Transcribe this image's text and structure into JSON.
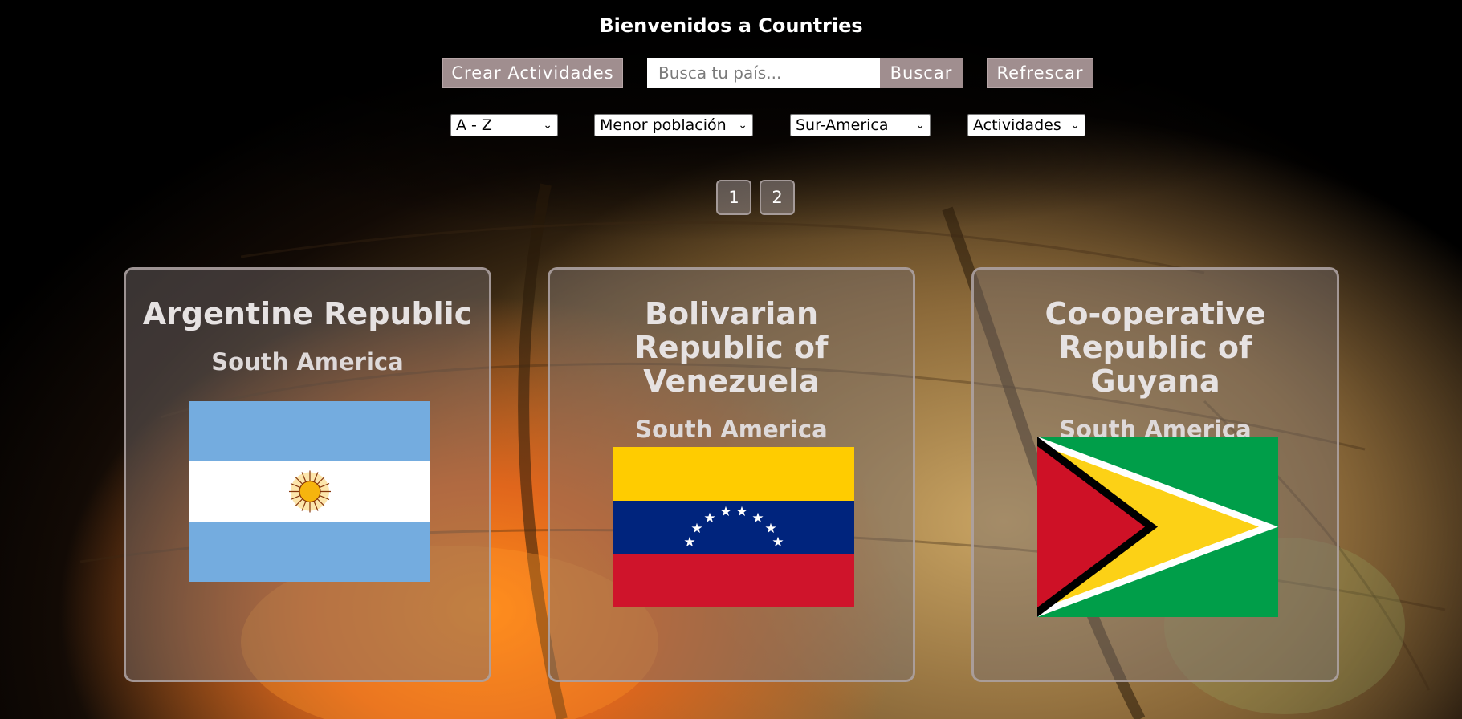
{
  "header": {
    "title": "Bienvenidos a Countries",
    "create_button": "Crear Actividades",
    "search_placeholder": "Busca tu país...",
    "search_button": "Buscar",
    "refresh_button": "Refrescar"
  },
  "filters": {
    "order": "A - Z",
    "population": "Menor población",
    "continent": "Sur-America",
    "activities": "Actividades"
  },
  "pagination": {
    "pages": [
      "1",
      "2"
    ]
  },
  "cards": [
    {
      "name": "Argentine Republic",
      "continent": "South America",
      "flag": "flag-argentina"
    },
    {
      "name": "Bolivarian Republic of Venezuela",
      "continent": "South America",
      "flag": "flag-venezuela"
    },
    {
      "name": "Co-operative Republic of Guyana",
      "continent": "South America",
      "flag": "flag-guyana"
    }
  ],
  "colors": {
    "button_bg": "#a08e8f",
    "card_border": "#afa5a5"
  }
}
